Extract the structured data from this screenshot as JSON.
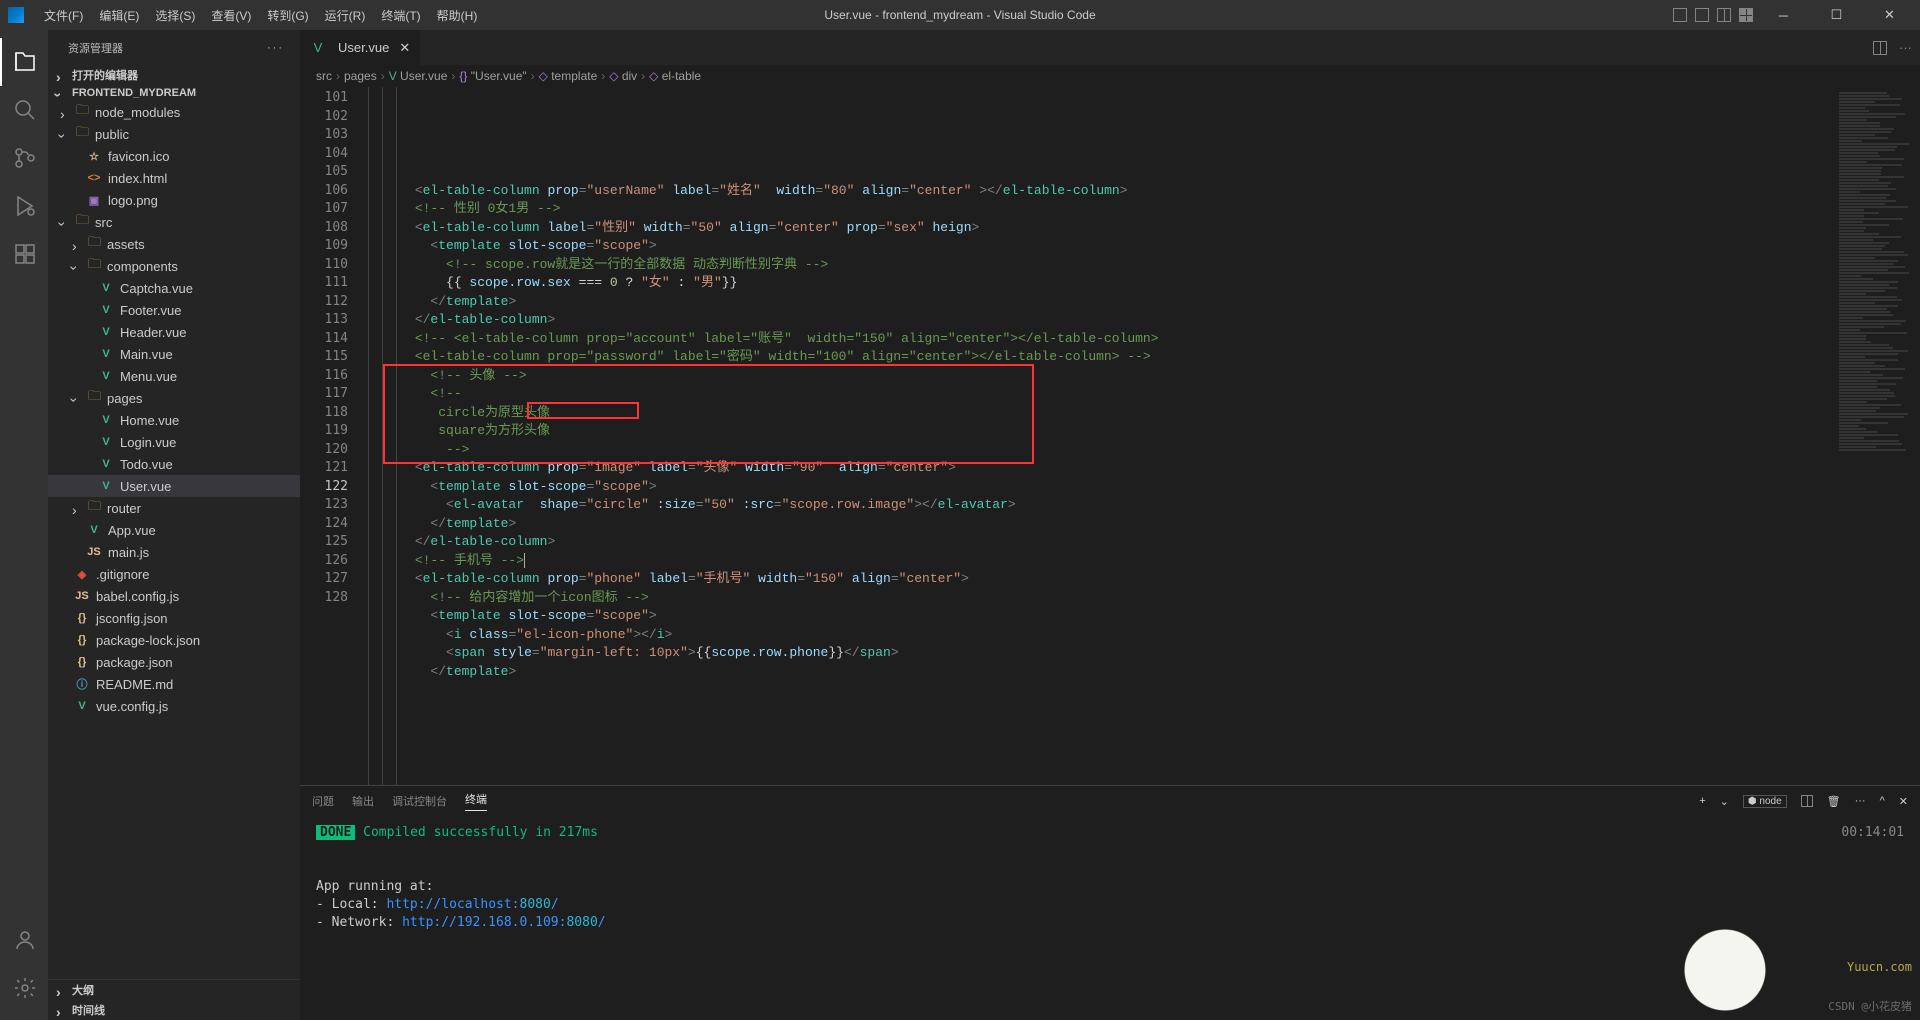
{
  "title": "User.vue - frontend_mydream - Visual Studio Code",
  "menus": [
    "文件(F)",
    "编辑(E)",
    "选择(S)",
    "查看(V)",
    "转到(G)",
    "运行(R)",
    "终端(T)",
    "帮助(H)"
  ],
  "sidebar": {
    "title": "资源管理器",
    "section1": "打开的编辑器",
    "section2": "FRONTEND_MYDREAM",
    "outline": "大纲",
    "timeline": "时间线"
  },
  "tree": [
    {
      "d": 1,
      "t": "folder",
      "chev": ">",
      "name": "node_modules",
      "c": "#c09553"
    },
    {
      "d": 1,
      "t": "folder",
      "chev": "v",
      "name": "public",
      "c": "#c09553"
    },
    {
      "d": 2,
      "t": "file",
      "icon": "☆",
      "name": "favicon.ico",
      "ic": "#e2c08d"
    },
    {
      "d": 2,
      "t": "file",
      "icon": "<>",
      "name": "index.html",
      "ic": "#e37933"
    },
    {
      "d": 2,
      "t": "file",
      "icon": "▣",
      "name": "logo.png",
      "ic": "#a074c4"
    },
    {
      "d": 1,
      "t": "folder",
      "chev": "v",
      "name": "src",
      "c": "#c09553"
    },
    {
      "d": 2,
      "t": "folder",
      "chev": ">",
      "name": "assets",
      "c": "#c09553"
    },
    {
      "d": 2,
      "t": "folder",
      "chev": "v",
      "name": "components",
      "c": "#c09553"
    },
    {
      "d": 3,
      "t": "file",
      "icon": "V",
      "name": "Captcha.vue",
      "ic": "#41b883"
    },
    {
      "d": 3,
      "t": "file",
      "icon": "V",
      "name": "Footer.vue",
      "ic": "#41b883"
    },
    {
      "d": 3,
      "t": "file",
      "icon": "V",
      "name": "Header.vue",
      "ic": "#41b883"
    },
    {
      "d": 3,
      "t": "file",
      "icon": "V",
      "name": "Main.vue",
      "ic": "#41b883"
    },
    {
      "d": 3,
      "t": "file",
      "icon": "V",
      "name": "Menu.vue",
      "ic": "#41b883"
    },
    {
      "d": 2,
      "t": "folder",
      "chev": "v",
      "name": "pages",
      "c": "#c09553"
    },
    {
      "d": 3,
      "t": "file",
      "icon": "V",
      "name": "Home.vue",
      "ic": "#41b883"
    },
    {
      "d": 3,
      "t": "file",
      "icon": "V",
      "name": "Login.vue",
      "ic": "#41b883"
    },
    {
      "d": 3,
      "t": "file",
      "icon": "V",
      "name": "Todo.vue",
      "ic": "#41b883"
    },
    {
      "d": 3,
      "t": "file",
      "icon": "V",
      "name": "User.vue",
      "ic": "#41b883",
      "active": true
    },
    {
      "d": 2,
      "t": "folder",
      "chev": ">",
      "name": "router",
      "c": "#c09553"
    },
    {
      "d": 2,
      "t": "file",
      "icon": "V",
      "name": "App.vue",
      "ic": "#41b883"
    },
    {
      "d": 2,
      "t": "file",
      "icon": "JS",
      "name": "main.js",
      "ic": "#e2c08d"
    },
    {
      "d": 1,
      "t": "file",
      "icon": "◈",
      "name": ".gitignore",
      "ic": "#e8503f"
    },
    {
      "d": 1,
      "t": "file",
      "icon": "JS",
      "name": "babel.config.js",
      "ic": "#e2c08d"
    },
    {
      "d": 1,
      "t": "file",
      "icon": "{}",
      "name": "jsconfig.json",
      "ic": "#e2c08d"
    },
    {
      "d": 1,
      "t": "file",
      "icon": "{}",
      "name": "package-lock.json",
      "ic": "#e2c08d"
    },
    {
      "d": 1,
      "t": "file",
      "icon": "{}",
      "name": "package.json",
      "ic": "#e2c08d"
    },
    {
      "d": 1,
      "t": "file",
      "icon": "ⓘ",
      "name": "README.md",
      "ic": "#519aba"
    },
    {
      "d": 1,
      "t": "file",
      "icon": "V",
      "name": "vue.config.js",
      "ic": "#41b883"
    }
  ],
  "tab": {
    "name": "User.vue"
  },
  "breadcrumb": [
    "src",
    "pages",
    "User.vue",
    "\"User.vue\"",
    "template",
    "div",
    "el-table"
  ],
  "line_start": 101,
  "line_end": 128,
  "current_line": 122,
  "terminal_tabs": [
    "问题",
    "输出",
    "调试控制台",
    "终端"
  ],
  "terminal_shell": "node",
  "terminal": {
    "done": "DONE",
    "compiled": "Compiled successfully in 217ms",
    "time": "00:14:01",
    "app_running": "App running at:",
    "local_label": "- Local:   ",
    "local_url": "http://localhost:",
    "local_port": "8080",
    "net_label": "- Network: ",
    "net_url": "http://192.168.0.109:",
    "net_port": "8080"
  },
  "watermark_site": "Yuucn.com",
  "watermark_csdn": "CSDN @小花皮猪"
}
